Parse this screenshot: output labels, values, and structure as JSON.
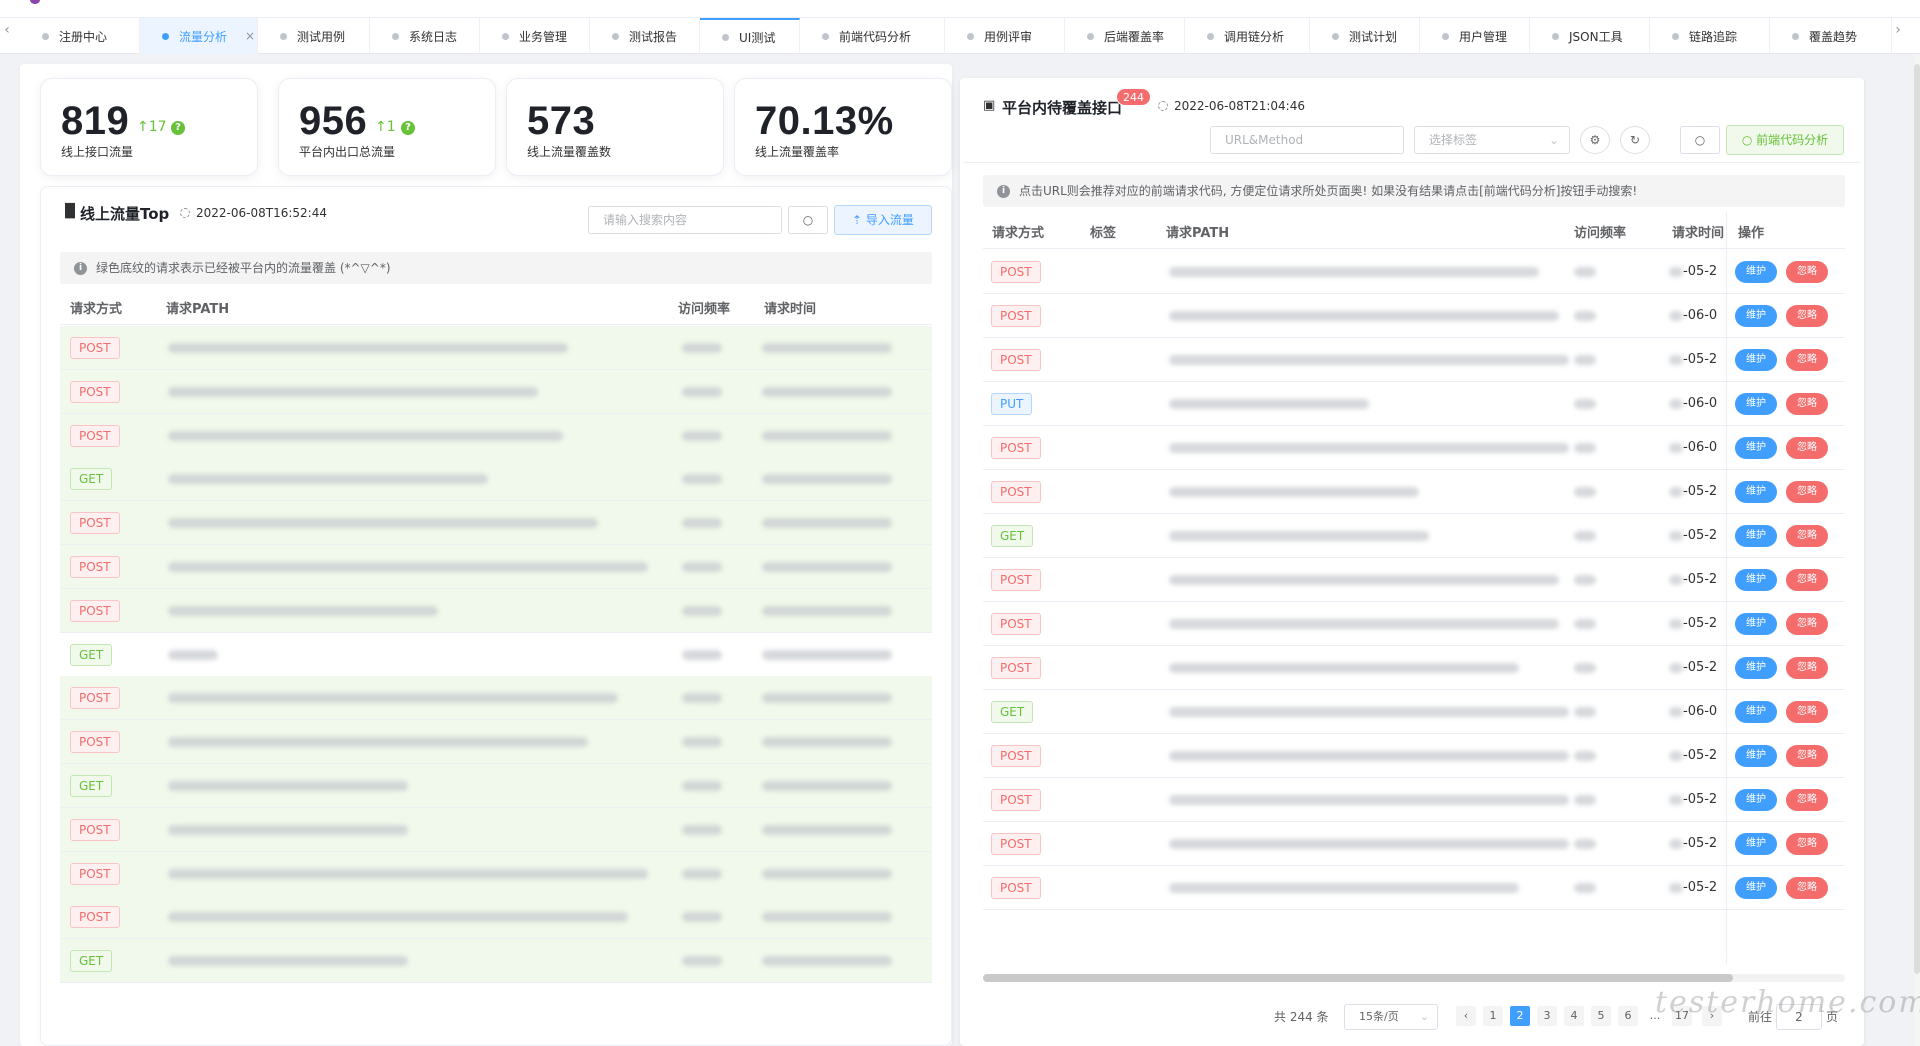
{
  "tabs": [
    {
      "label": "注册中心",
      "active": false
    },
    {
      "label": "流量分析",
      "active": true
    },
    {
      "label": "测试用例",
      "active": false
    },
    {
      "label": "系统日志",
      "active": false
    },
    {
      "label": "业务管理",
      "active": false
    },
    {
      "label": "测试报告",
      "active": false
    },
    {
      "label": "UI测试",
      "active": false
    },
    {
      "label": "前端代码分析",
      "active": false
    },
    {
      "label": "用例评审",
      "active": false
    },
    {
      "label": "后端覆盖率",
      "active": false
    },
    {
      "label": "调用链分析",
      "active": false
    },
    {
      "label": "测试计划",
      "active": false
    },
    {
      "label": "用户管理",
      "active": false
    },
    {
      "label": "JSON工具",
      "active": false
    },
    {
      "label": "链路追踪",
      "active": false
    },
    {
      "label": "覆盖趋势",
      "active": false
    }
  ],
  "tab_close": "×",
  "tab_prev": "‹",
  "tab_next": "›",
  "stats": [
    {
      "value": "819",
      "delta": "↑17",
      "label": "线上接口流量",
      "help": "?"
    },
    {
      "value": "956",
      "delta": "↑1",
      "label": "平台内出口总流量",
      "help": "?"
    },
    {
      "value": "573",
      "delta": "",
      "label": "线上流量覆盖数",
      "help": ""
    },
    {
      "value": "70.13%",
      "delta": "",
      "label": "线上流量覆盖率",
      "help": ""
    }
  ],
  "left": {
    "title": "线上流量Top",
    "time": "2022-06-08T16:52:44",
    "search_placeholder": "请输入搜索内容",
    "import_label": "导入流量",
    "notice": "绿色底纹的请求表示已经被平台内的流量覆盖 (*^▽^*)",
    "columns": [
      "请求方式",
      "请求PATH",
      "访问频率",
      "请求时间"
    ],
    "rows": [
      {
        "method": "POST",
        "green": true
      },
      {
        "method": "POST",
        "green": true
      },
      {
        "method": "POST",
        "green": true
      },
      {
        "method": "GET",
        "green": true
      },
      {
        "method": "POST",
        "green": true
      },
      {
        "method": "POST",
        "green": true
      },
      {
        "method": "POST",
        "green": true
      },
      {
        "method": "GET",
        "green": false
      },
      {
        "method": "POST",
        "green": true
      },
      {
        "method": "POST",
        "green": true
      },
      {
        "method": "GET",
        "green": true
      },
      {
        "method": "POST",
        "green": true
      },
      {
        "method": "POST",
        "green": true
      },
      {
        "method": "POST",
        "green": true
      },
      {
        "method": "GET",
        "green": true
      }
    ]
  },
  "right": {
    "title": "平台内待覆盖接口",
    "badge": "244",
    "time": "2022-06-08T21:04:46",
    "url_placeholder": "URL&Method",
    "tag_placeholder": "选择标签",
    "analyze_label": "前端代码分析",
    "notice": "点击URL则会推荐对应的前端请求代码, 方便定位请求所处页面奥! 如果没有结果请点击[前端代码分析]按钮手动搜索!",
    "columns": [
      "请求方式",
      "标签",
      "请求PATH",
      "访问频率",
      "请求时间",
      "操作"
    ],
    "maintain": "维护",
    "ignore": "忽略",
    "rows": [
      {
        "method": "POST",
        "time": "-05-2"
      },
      {
        "method": "POST",
        "time": "-06-0"
      },
      {
        "method": "POST",
        "time": "-05-2"
      },
      {
        "method": "PUT",
        "time": "-06-0"
      },
      {
        "method": "POST",
        "time": "-06-0"
      },
      {
        "method": "POST",
        "time": "-05-2"
      },
      {
        "method": "GET",
        "time": "-05-2"
      },
      {
        "method": "POST",
        "time": "-05-2"
      },
      {
        "method": "POST",
        "time": "-05-2"
      },
      {
        "method": "POST",
        "time": "-05-2"
      },
      {
        "method": "GET",
        "time": "-06-0"
      },
      {
        "method": "POST",
        "time": "-05-2"
      },
      {
        "method": "POST",
        "time": "-05-2"
      },
      {
        "method": "POST",
        "time": "-05-2"
      },
      {
        "method": "POST",
        "time": "-05-2"
      }
    ],
    "pager": {
      "total": "共 244 条",
      "page_size": "15条/页",
      "pages": [
        "1",
        "2",
        "3",
        "4",
        "5",
        "6",
        "...",
        "17"
      ],
      "current": "2",
      "goto_label": "前往",
      "goto_value": "2",
      "page_suffix": "页"
    }
  },
  "watermark": "testerhome.com"
}
